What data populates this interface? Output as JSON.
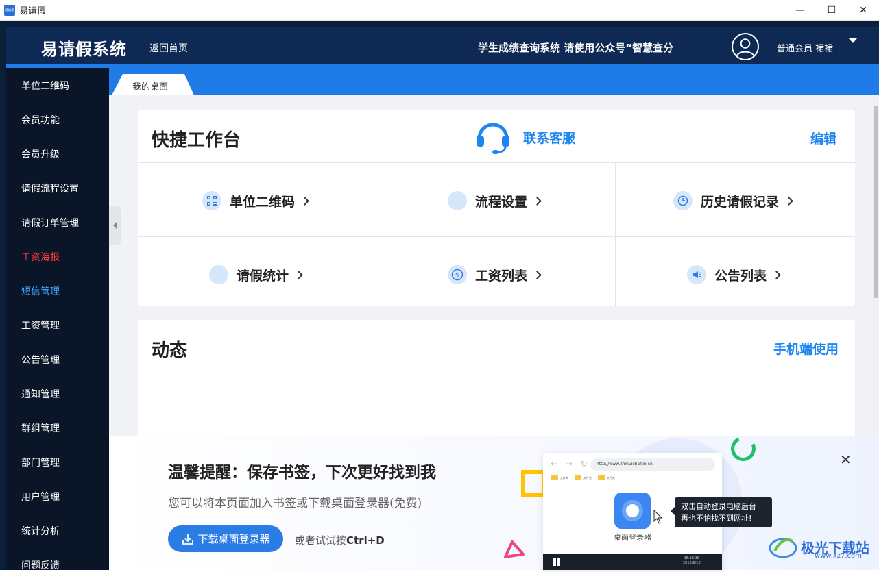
{
  "window": {
    "title": "易请假",
    "app_icon_text": "易请假",
    "controls": {
      "minimize": "—",
      "maximize": "☐",
      "close": "✕"
    }
  },
  "header": {
    "logo": "易请假系统",
    "home_link": "返回首页",
    "marquee": "学生成绩查询系统 请使用公众号“智慧查分",
    "member": "普通会员 裙裙"
  },
  "sidebar": {
    "items": [
      {
        "label": "单位二维码",
        "state": "normal"
      },
      {
        "label": "会员功能",
        "state": "normal"
      },
      {
        "label": "会员升级",
        "state": "normal"
      },
      {
        "label": "请假流程设置",
        "state": "normal"
      },
      {
        "label": "请假订单管理",
        "state": "normal"
      },
      {
        "label": "工资海报",
        "state": "highlight-red"
      },
      {
        "label": "短信管理",
        "state": "highlight-blue"
      },
      {
        "label": "工资管理",
        "state": "normal"
      },
      {
        "label": "公告管理",
        "state": "normal"
      },
      {
        "label": "通知管理",
        "state": "normal"
      },
      {
        "label": "群组管理",
        "state": "normal"
      },
      {
        "label": "部门管理",
        "state": "normal"
      },
      {
        "label": "用户管理",
        "state": "normal"
      },
      {
        "label": "统计分析",
        "state": "normal"
      },
      {
        "label": "问题反馈",
        "state": "normal"
      }
    ]
  },
  "tabs": [
    {
      "label": "我的桌面",
      "active": true
    }
  ],
  "workbench": {
    "title": "快捷工作台",
    "customer_service": "联系客服",
    "edit": "编辑",
    "tiles": [
      {
        "label": "单位二维码",
        "icon": "qr-code-icon"
      },
      {
        "label": "流程设置",
        "icon": "flow-icon"
      },
      {
        "label": "历史请假记录",
        "icon": "clock-icon"
      },
      {
        "label": "请假统计",
        "icon": "stats-icon"
      },
      {
        "label": "工资列表",
        "icon": "dollar-icon"
      },
      {
        "label": "公告列表",
        "icon": "megaphone-icon"
      }
    ]
  },
  "activity": {
    "title": "动态",
    "mobile_link": "手机端使用"
  },
  "banner": {
    "title": "温馨提醒：保存书签，下次更好找到我",
    "subtitle": "您可以将本页面加入书签或下载桌面登录器(免费)",
    "download_button": "下载桌面登录器",
    "or_prefix": "或者试试按",
    "shortcut": "Ctrl+D",
    "close": "✕",
    "mock": {
      "url": "http://www.zhihuichafen.cn",
      "folders": [
        "文件夹",
        "文件夹",
        "文件夹"
      ],
      "app_label": "桌面登录器",
      "tip_line1": "双击自动登录电脑后台",
      "tip_line2": "再也不怕找不到网址!",
      "tray_time": "18:18:18",
      "tray_date": "2018/8/18"
    }
  },
  "watermark": {
    "text": "极光下载站",
    "url": "www.xz7.com"
  },
  "colors": {
    "header_bg": "#0e2954",
    "sidebar_bg": "#0a1628",
    "accent_blue": "#1e7be8",
    "link_blue": "#1e86f0",
    "red": "#ff3b3b"
  }
}
